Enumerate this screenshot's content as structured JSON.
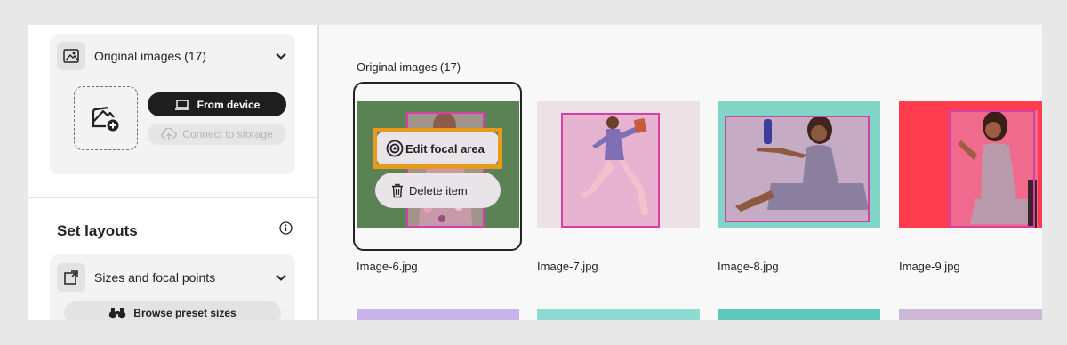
{
  "left_panel": {
    "original_card": {
      "title": "Original images (17)",
      "from_device": "From device",
      "connect_storage": "Connect to storage"
    },
    "set_layouts": {
      "title": "Set layouts",
      "sizes_card": {
        "title": "Sizes and focal points",
        "browse": "Browse preset sizes"
      }
    }
  },
  "main": {
    "title": "Original images (17)",
    "images": [
      {
        "name": "Image-6.jpg",
        "selected": true
      },
      {
        "name": "Image-7.jpg",
        "selected": false
      },
      {
        "name": "Image-8.jpg",
        "selected": false
      },
      {
        "name": "Image-9.jpg",
        "selected": false
      }
    ],
    "context_menu": {
      "edit_focal": "Edit focal area",
      "delete_item": "Delete item"
    }
  },
  "colors": {
    "focal_outline": "#d63fa8",
    "highlight": "#e89a1a",
    "thumb_bg_1": "#2e9a3c",
    "thumb_bg_2": "#ebd4e0",
    "thumb_bg_3": "#7fd6c6",
    "thumb_bg_4": "#ff3d4f"
  },
  "icons": [
    "image-icon",
    "chevron-down-icon",
    "add-image-icon",
    "laptop-icon",
    "cloud-upload-icon",
    "info-icon",
    "crop-icon",
    "binoculars-icon",
    "target-icon",
    "trash-icon"
  ]
}
